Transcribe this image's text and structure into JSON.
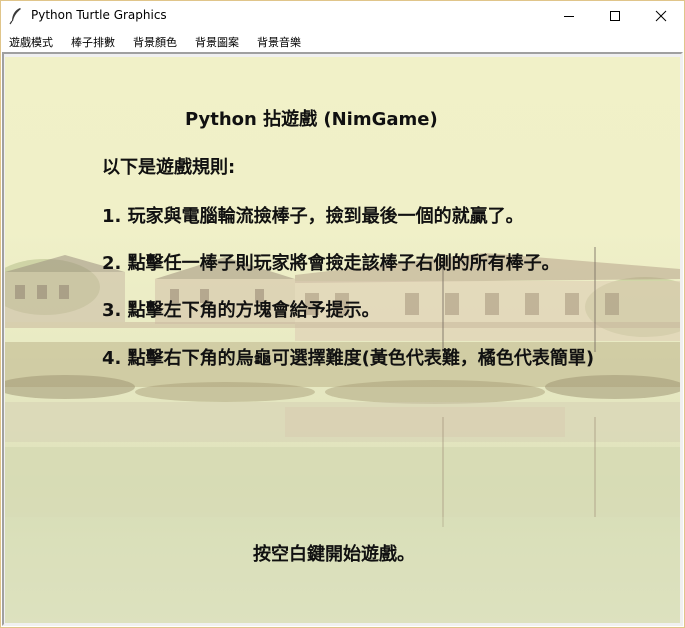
{
  "window": {
    "title": "Python Turtle Graphics"
  },
  "menu": {
    "items": [
      "遊戲模式",
      "棒子排數",
      "背景顏色",
      "背景圖案",
      "背景音樂"
    ]
  },
  "canvas": {
    "title": "Python 拈遊戲 (NimGame)",
    "intro": "以下是遊戲規則:",
    "rules": [
      "1. 玩家與電腦輪流撿棒子，撿到最後一個的就贏了。",
      "2. 點擊任一棒子則玩家將會撿走該棒子右側的所有棒子。",
      "3. 點擊左下角的方塊會給予提示。",
      "4. 點擊右下角的烏龜可選擇難度(黃色代表難，橘色代表簡單)"
    ],
    "start_prompt": "按空白鍵開始遊戲。"
  },
  "icons": {
    "app": "feather-icon",
    "minimize": "minimize-icon",
    "maximize": "maximize-icon",
    "close": "close-icon"
  },
  "colors": {
    "canvas_tint": "#f0f0c8",
    "text": "#111111"
  }
}
